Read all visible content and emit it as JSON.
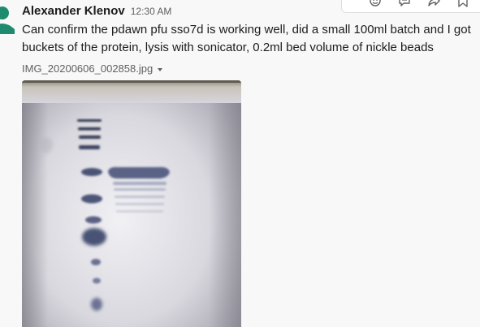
{
  "message": {
    "author": "Alexander Klenov",
    "time": "12:30 AM",
    "text": "Can confirm the pdawn pfu sso7d is working well, did a small 100ml batch and I got buckets of the protein, lysis with sonicator, 0.2ml bed volume of nickle beads",
    "attachment": {
      "filename": "IMG_20200606_002858.jpg",
      "dropdown_icon": "caret-down-icon",
      "image": "photo of SDS-PAGE protein gel with ladder and protein band"
    }
  },
  "toolbar": {
    "icons": [
      "emoji-reaction-icon",
      "reply-thread-icon",
      "share-message-icon",
      "save-bookmark-icon"
    ]
  },
  "avatar": {
    "icon": "user-avatar-icon",
    "color": "#1e8a6e"
  }
}
